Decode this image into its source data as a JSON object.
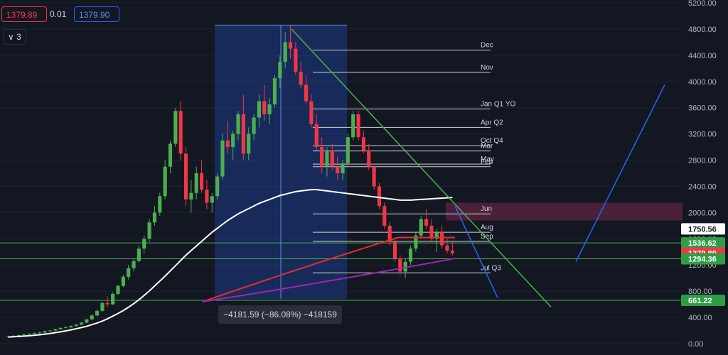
{
  "toolbar": {
    "bid": "1379.89",
    "spread": "0.01",
    "ask": "1379.90",
    "layers_label": "3"
  },
  "measure_label": "−4181.59 (−86.08%) −418159",
  "chart_data": {
    "type": "candlestick",
    "ylim": [
      0,
      5200
    ],
    "y_ticks": [
      0,
      400,
      800,
      1200,
      1600,
      2000,
      2400,
      2800,
      3200,
      3600,
      4000,
      4400,
      4800,
      5200
    ],
    "y_tick_labels": [
      "0.00",
      "400.00",
      "800.00",
      "1200.00",
      "1600.00",
      "2000.00",
      "2400.00",
      "2800.00",
      "3200.00",
      "3600.00",
      "4000.00",
      "4400.00",
      "4800.00",
      "5200.00"
    ],
    "price_scale_labels": [
      {
        "text": "1750.56",
        "value": 1750.56,
        "bg": "#ffffff",
        "fg": "#131722"
      },
      {
        "text": "1536.62",
        "value": 1536.62,
        "bg": "#2e9e44",
        "fg": "#ffffff"
      },
      {
        "text": "1379.89",
        "value": 1379.89,
        "bg": "#f23645",
        "fg": "#ffffff"
      },
      {
        "text": "1294.36",
        "value": 1294.36,
        "bg": "#2e9e44",
        "fg": "#ffffff"
      },
      {
        "text": "661.22",
        "value": 661.22,
        "bg": "#2e9e44",
        "fg": "#ffffff"
      }
    ],
    "month_levels": [
      {
        "label": "Dec",
        "value": 4480
      },
      {
        "label": "Nov",
        "value": 4140
      },
      {
        "label": "Jan Q1 YO",
        "value": 3580
      },
      {
        "label": "Apr Q2",
        "value": 3300
      },
      {
        "label": "Oct Q4",
        "value": 3020
      },
      {
        "label": "Mar",
        "value": 2940
      },
      {
        "label": "May",
        "value": 2740
      },
      {
        "label": "Feb",
        "value": 2700
      },
      {
        "label": "Jun",
        "value": 1980
      },
      {
        "label": "Aug",
        "value": 1700
      },
      {
        "label": "Sep",
        "value": 1560
      },
      {
        "label": "Jul Q3",
        "value": 1080
      }
    ],
    "horizontal_levels": [
      1536.62,
      1294.36,
      661.22
    ],
    "measure": {
      "from": 4860,
      "to": 678,
      "change": "−4181.59 (−86.08%)"
    },
    "candles": [
      [
        100,
        120,
        90,
        110
      ],
      [
        110,
        130,
        100,
        120
      ],
      [
        120,
        135,
        110,
        130
      ],
      [
        130,
        150,
        120,
        140
      ],
      [
        140,
        160,
        130,
        150
      ],
      [
        150,
        170,
        140,
        160
      ],
      [
        160,
        180,
        150,
        170
      ],
      [
        170,
        200,
        160,
        190
      ],
      [
        190,
        210,
        180,
        200
      ],
      [
        200,
        230,
        190,
        220
      ],
      [
        220,
        250,
        210,
        240
      ],
      [
        240,
        270,
        230,
        250
      ],
      [
        250,
        280,
        240,
        270
      ],
      [
        270,
        300,
        260,
        290
      ],
      [
        290,
        330,
        280,
        320
      ],
      [
        320,
        380,
        310,
        370
      ],
      [
        370,
        450,
        360,
        430
      ],
      [
        430,
        520,
        420,
        500
      ],
      [
        500,
        640,
        480,
        620
      ],
      [
        620,
        720,
        560,
        600
      ],
      [
        600,
        780,
        590,
        760
      ],
      [
        760,
        900,
        740,
        880
      ],
      [
        880,
        1050,
        860,
        1020
      ],
      [
        1020,
        1200,
        980,
        1150
      ],
      [
        1150,
        1300,
        1100,
        1260
      ],
      [
        1260,
        1500,
        1240,
        1450
      ],
      [
        1450,
        1650,
        1380,
        1600
      ],
      [
        1600,
        1900,
        1550,
        1850
      ],
      [
        1850,
        2100,
        1800,
        2000
      ],
      [
        2000,
        2300,
        1950,
        2250
      ],
      [
        2250,
        2800,
        2200,
        2700
      ],
      [
        2700,
        3100,
        2600,
        3050
      ],
      [
        3050,
        3600,
        3000,
        3550
      ],
      [
        3550,
        3700,
        2800,
        2900
      ],
      [
        2900,
        3000,
        2100,
        2200
      ],
      [
        2200,
        2500,
        2000,
        2300
      ],
      [
        2300,
        2700,
        2200,
        2600
      ],
      [
        2600,
        2800,
        2300,
        2350
      ],
      [
        2350,
        2500,
        2050,
        2150
      ],
      [
        2150,
        2300,
        2000,
        2250
      ],
      [
        2250,
        2600,
        2200,
        2550
      ],
      [
        2550,
        3200,
        2500,
        3100
      ],
      [
        3100,
        3400,
        2900,
        3000
      ],
      [
        3000,
        3250,
        2800,
        3200
      ],
      [
        3200,
        3550,
        3100,
        3500
      ],
      [
        3500,
        3800,
        2800,
        2900
      ],
      [
        2900,
        3300,
        2800,
        3200
      ],
      [
        3200,
        3500,
        3100,
        3450
      ],
      [
        3450,
        3800,
        3300,
        3700
      ],
      [
        3700,
        3950,
        3400,
        3500
      ],
      [
        3500,
        3750,
        3350,
        3650
      ],
      [
        3650,
        4100,
        3600,
        4050
      ],
      [
        4050,
        4400,
        3900,
        4300
      ],
      [
        4300,
        4750,
        4200,
        4600
      ],
      [
        4600,
        4860,
        4350,
        4500
      ],
      [
        4500,
        4600,
        4100,
        4150
      ],
      [
        4150,
        4300,
        3900,
        3950
      ],
      [
        3950,
        4100,
        3650,
        3700
      ],
      [
        3700,
        3800,
        3300,
        3350
      ],
      [
        3350,
        3500,
        2950,
        3000
      ],
      [
        3000,
        3150,
        2600,
        2700
      ],
      [
        2700,
        3000,
        2550,
        2950
      ],
      [
        2950,
        3050,
        2650,
        2700
      ],
      [
        2700,
        2850,
        2500,
        2600
      ],
      [
        2600,
        2800,
        2500,
        2750
      ],
      [
        2750,
        3200,
        2700,
        3150
      ],
      [
        3150,
        3550,
        3100,
        3500
      ],
      [
        3500,
        3550,
        3100,
        3150
      ],
      [
        3150,
        3250,
        2900,
        2950
      ],
      [
        2950,
        3050,
        2650,
        2700
      ],
      [
        2700,
        2750,
        2350,
        2400
      ],
      [
        2400,
        2450,
        2050,
        2100
      ],
      [
        2100,
        2150,
        1750,
        1800
      ],
      [
        1800,
        1850,
        1500,
        1550
      ],
      [
        1550,
        1600,
        1250,
        1300
      ],
      [
        1300,
        1350,
        1050,
        1100
      ],
      [
        1100,
        1300,
        1000,
        1250
      ],
      [
        1250,
        1500,
        1200,
        1450
      ],
      [
        1450,
        1700,
        1400,
        1650
      ],
      [
        1650,
        1950,
        1600,
        1900
      ],
      [
        1900,
        2050,
        1750,
        1800
      ],
      [
        1800,
        1900,
        1550,
        1600
      ],
      [
        1600,
        1750,
        1400,
        1700
      ],
      [
        1700,
        1800,
        1450,
        1500
      ],
      [
        1500,
        1600,
        1380,
        1420
      ],
      [
        1420,
        1550,
        1350,
        1380
      ]
    ],
    "moving_averages": [
      {
        "name": "MA white",
        "color": "#ffffff",
        "values": [
          100,
          105,
          110,
          115,
          120,
          128,
          135,
          145,
          155,
          168,
          180,
          195,
          210,
          228,
          245,
          265,
          290,
          315,
          345,
          380,
          420,
          460,
          505,
          555,
          610,
          670,
          735,
          805,
          880,
          955,
          1030,
          1110,
          1190,
          1270,
          1350,
          1420,
          1490,
          1560,
          1630,
          1700,
          1760,
          1820,
          1880,
          1930,
          1980,
          2020,
          2060,
          2100,
          2140,
          2170,
          2200,
          2230,
          2260,
          2280,
          2300,
          2320,
          2330,
          2340,
          2350,
          2350,
          2340,
          2330,
          2320,
          2310,
          2300,
          2290,
          2280,
          2270,
          2260,
          2250,
          2240,
          2230,
          2220,
          2210,
          2200,
          2190,
          2190,
          2190,
          2195,
          2200,
          2205,
          2210,
          2215,
          2220,
          2225,
          2230
        ]
      },
      {
        "name": "MA red",
        "color": "#e03030",
        "values": [
          null,
          null,
          null,
          null,
          null,
          null,
          null,
          null,
          null,
          null,
          null,
          null,
          null,
          null,
          null,
          null,
          null,
          null,
          null,
          null,
          null,
          null,
          null,
          null,
          null,
          null,
          null,
          null,
          null,
          null,
          null,
          null,
          null,
          null,
          null,
          null,
          null,
          null,
          null,
          null,
          null,
          null,
          null,
          null,
          null,
          null,
          null,
          null,
          null,
          null,
          null,
          null,
          null,
          null,
          null,
          null,
          null,
          null,
          null,
          null,
          null,
          null,
          null,
          null,
          null,
          null,
          null,
          null,
          null,
          null,
          null,
          null,
          null,
          null,
          null,
          null,
          null,
          null,
          null,
          null,
          null,
          null,
          null,
          null,
          null,
          null
        ]
      },
      {
        "name": "MA purple",
        "color": "#9c27b0",
        "values": []
      }
    ]
  }
}
